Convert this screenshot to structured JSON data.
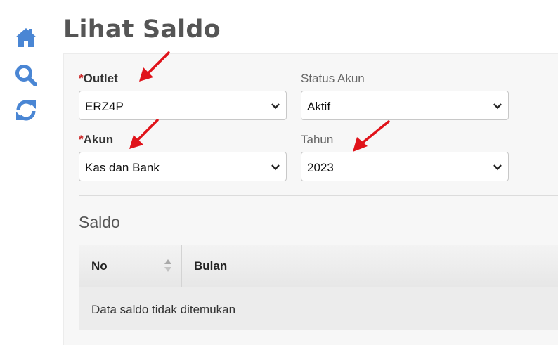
{
  "page": {
    "title": "Lihat Saldo"
  },
  "sidebar": {
    "icons": [
      "home-icon",
      "search-icon",
      "refresh-icon"
    ],
    "icon_color": "#4a86d4"
  },
  "filters": {
    "outlet": {
      "required_mark": "*",
      "label": "Outlet",
      "value": "ERZ4P"
    },
    "status_akun": {
      "label": "Status Akun",
      "value": "Aktif"
    },
    "akun": {
      "required_mark": "*",
      "label": "Akun",
      "value": "Kas dan Bank"
    },
    "tahun": {
      "label": "Tahun",
      "value": "2023"
    }
  },
  "saldo": {
    "title": "Saldo",
    "columns": [
      "No",
      "Bulan"
    ],
    "empty_message": "Data saldo tidak ditemukan"
  },
  "colors": {
    "required": "#cc2b2b",
    "annotation_arrow": "#e0131a"
  }
}
